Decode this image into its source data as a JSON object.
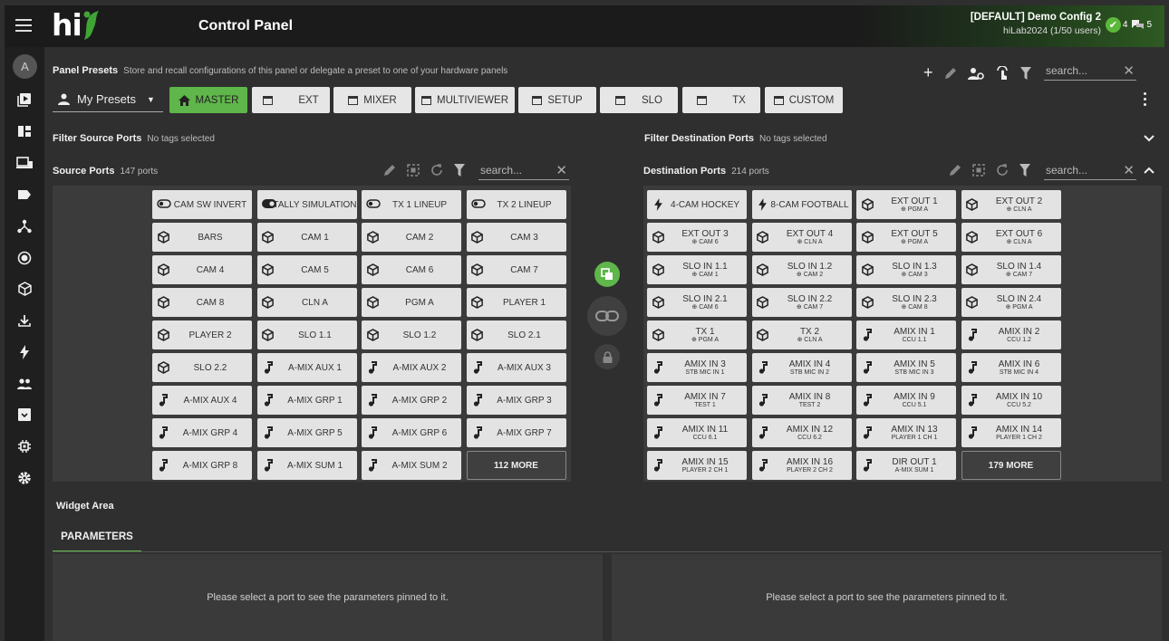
{
  "header": {
    "title": "Control Panel",
    "logo_text": "hi",
    "config_name": "[DEFAULT] Demo Config 2",
    "config_users": "hiLab2024 (1/50 users)",
    "status_ok_count": "4",
    "status_msg_count": "5"
  },
  "sidebar": {
    "avatar": "A",
    "items": [
      "play-box-icon",
      "dashboard-icon",
      "devices-icon",
      "label-icon",
      "topology-icon",
      "record-icon",
      "cube-icon",
      "download-icon",
      "flash-icon",
      "users-icon",
      "archive-icon",
      "chip-icon",
      "gear-icon"
    ]
  },
  "presets": {
    "title": "Panel Presets",
    "subtitle": "Store and recall configurations of this panel or delegate a preset to one of your hardware panels",
    "my_presets": "My Presets",
    "search_placeholder": "search...",
    "buttons": [
      "MASTER",
      "EXT",
      "MIXER",
      "MULTIVIEWER",
      "SETUP",
      "SLO",
      "TX",
      "CUSTOM"
    ]
  },
  "filters": {
    "source_label": "Filter Source Ports",
    "source_value": "No tags selected",
    "dest_label": "Filter Destination Ports",
    "dest_value": "No tags selected"
  },
  "source": {
    "title": "Source Ports",
    "count": "147 ports",
    "search_placeholder": "search...",
    "ports": [
      {
        "l1": "CAM SW INVERT",
        "icon": "toggle"
      },
      {
        "l1": "TALLY SIMULATION",
        "icon": "toggle-on"
      },
      {
        "l1": "TX 1 LINEUP",
        "icon": "toggle"
      },
      {
        "l1": "TX 2 LINEUP",
        "icon": "toggle"
      },
      {
        "l1": "BARS",
        "icon": "cube"
      },
      {
        "l1": "CAM 1",
        "icon": "cube"
      },
      {
        "l1": "CAM 2",
        "icon": "cube"
      },
      {
        "l1": "CAM 3",
        "icon": "cube"
      },
      {
        "l1": "CAM 4",
        "icon": "cube"
      },
      {
        "l1": "CAM 5",
        "icon": "cube"
      },
      {
        "l1": "CAM 6",
        "icon": "cube"
      },
      {
        "l1": "CAM 7",
        "icon": "cube"
      },
      {
        "l1": "CAM 8",
        "icon": "cube"
      },
      {
        "l1": "CLN A",
        "icon": "cube"
      },
      {
        "l1": "PGM A",
        "icon": "cube"
      },
      {
        "l1": "PLAYER 1",
        "icon": "cube"
      },
      {
        "l1": "PLAYER 2",
        "icon": "cube"
      },
      {
        "l1": "SLO 1.1",
        "icon": "cube"
      },
      {
        "l1": "SLO 1.2",
        "icon": "cube"
      },
      {
        "l1": "SLO 2.1",
        "icon": "cube"
      },
      {
        "l1": "SLO 2.2",
        "icon": "cube"
      },
      {
        "l1": "A-MIX AUX 1",
        "icon": "note"
      },
      {
        "l1": "A-MIX AUX 2",
        "icon": "note"
      },
      {
        "l1": "A-MIX AUX 3",
        "icon": "note"
      },
      {
        "l1": "A-MIX AUX 4",
        "icon": "note"
      },
      {
        "l1": "A-MIX GRP 1",
        "icon": "note"
      },
      {
        "l1": "A-MIX GRP 2",
        "icon": "note"
      },
      {
        "l1": "A-MIX GRP 3",
        "icon": "note"
      },
      {
        "l1": "A-MIX GRP 4",
        "icon": "note"
      },
      {
        "l1": "A-MIX GRP 5",
        "icon": "note"
      },
      {
        "l1": "A-MIX GRP 6",
        "icon": "note"
      },
      {
        "l1": "A-MIX GRP 7",
        "icon": "note"
      },
      {
        "l1": "A-MIX GRP 8",
        "icon": "note"
      },
      {
        "l1": "A-MIX SUM 1",
        "icon": "note"
      },
      {
        "l1": "A-MIX SUM 2",
        "icon": "note"
      },
      {
        "l1": "112 MORE",
        "icon": "more"
      }
    ]
  },
  "destination": {
    "title": "Destination Ports",
    "count": "214 ports",
    "search_placeholder": "search...",
    "ports": [
      {
        "l1": "4-CAM HOCKEY",
        "icon": "flash"
      },
      {
        "l1": "8-CAM FOOTBALL",
        "icon": "flash"
      },
      {
        "l1": "EXT OUT 1",
        "l2": "⊕ PGM A",
        "icon": "cube"
      },
      {
        "l1": "EXT OUT 2",
        "l2": "⊕ CLN A",
        "icon": "cube"
      },
      {
        "l1": "EXT OUT 3",
        "l2": "⊕ CAM 6",
        "icon": "cube"
      },
      {
        "l1": "EXT OUT 4",
        "l2": "⊕ CLN A",
        "icon": "cube"
      },
      {
        "l1": "EXT OUT 5",
        "l2": "⊕ PGM A",
        "icon": "cube"
      },
      {
        "l1": "EXT OUT 6",
        "l2": "⊕ CLN A",
        "icon": "cube"
      },
      {
        "l1": "SLO IN 1.1",
        "l2": "⊕ CAM 1",
        "icon": "cube"
      },
      {
        "l1": "SLO IN 1.2",
        "l2": "⊕ CAM 2",
        "icon": "cube"
      },
      {
        "l1": "SLO IN 1.3",
        "l2": "⊕ CAM 3",
        "icon": "cube"
      },
      {
        "l1": "SLO IN 1.4",
        "l2": "⊕ CAM 7",
        "icon": "cube"
      },
      {
        "l1": "SLO IN 2.1",
        "l2": "⊕ CAM 6",
        "icon": "cube"
      },
      {
        "l1": "SLO IN 2.2",
        "l2": "⊕ CAM 7",
        "icon": "cube"
      },
      {
        "l1": "SLO IN 2.3",
        "l2": "⊕ CAM 8",
        "icon": "cube"
      },
      {
        "l1": "SLO IN 2.4",
        "l2": "⊕ PGM A",
        "icon": "cube"
      },
      {
        "l1": "TX 1",
        "l2": "⊕ PGM A",
        "icon": "cube"
      },
      {
        "l1": "TX 2",
        "l2": "⊕ CLN A",
        "icon": "cube"
      },
      {
        "l1": "AMIX IN 1",
        "l2": "CCU 1.1",
        "icon": "note"
      },
      {
        "l1": "AMIX IN 2",
        "l2": "CCU 1.2",
        "icon": "note"
      },
      {
        "l1": "AMIX IN 3",
        "l2": "STB MIC IN 1",
        "icon": "note"
      },
      {
        "l1": "AMIX IN 4",
        "l2": "STB MIC IN 2",
        "icon": "note"
      },
      {
        "l1": "AMIX IN 5",
        "l2": "STB MIC IN 3",
        "icon": "note"
      },
      {
        "l1": "AMIX IN 6",
        "l2": "STB MIC IN 4",
        "icon": "note"
      },
      {
        "l1": "AMIX IN 7",
        "l2": "TEST 1",
        "icon": "note"
      },
      {
        "l1": "AMIX IN 8",
        "l2": "TEST 2",
        "icon": "note"
      },
      {
        "l1": "AMIX IN 9",
        "l2": "CCU 5.1",
        "icon": "note"
      },
      {
        "l1": "AMIX IN 10",
        "l2": "CCU 5.2",
        "icon": "note"
      },
      {
        "l1": "AMIX IN 11",
        "l2": "CCU 6.1",
        "icon": "note"
      },
      {
        "l1": "AMIX IN 12",
        "l2": "CCU 6.2",
        "icon": "note"
      },
      {
        "l1": "AMIX IN 13",
        "l2": "PLAYER 1 CH 1",
        "icon": "note"
      },
      {
        "l1": "AMIX IN 14",
        "l2": "PLAYER 1 CH 2",
        "icon": "note"
      },
      {
        "l1": "AMIX IN 15",
        "l2": "PLAYER 2 CH 1",
        "icon": "note"
      },
      {
        "l1": "AMIX IN 16",
        "l2": "PLAYER 2 CH 2",
        "icon": "note"
      },
      {
        "l1": "DIR OUT 1",
        "l2": "A-MIX SUM 1",
        "icon": "note"
      },
      {
        "l1": "179 MORE",
        "icon": "more"
      }
    ]
  },
  "widget": {
    "title": "Widget Area",
    "tab": "PARAMETERS",
    "left_msg": "Please select a port to see the parameters pinned to it.",
    "right_msg": "Please select a port to see the parameters pinned to it."
  },
  "colors": {
    "accent": "#5fb64a",
    "background": "#2f2f2f",
    "port": "#e3e3e3"
  }
}
